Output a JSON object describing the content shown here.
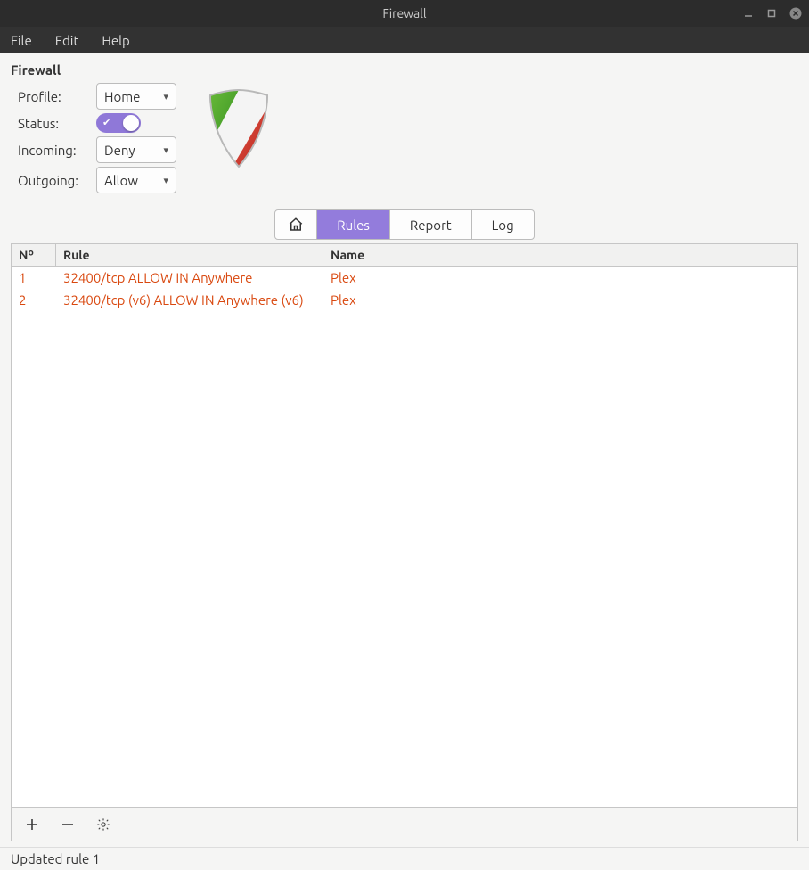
{
  "window": {
    "title": "Firewall"
  },
  "menu": {
    "file": "File",
    "edit": "Edit",
    "help": "Help"
  },
  "section": {
    "heading": "Firewall"
  },
  "form": {
    "profile_label": "Profile:",
    "profile_value": "Home",
    "status_label": "Status:",
    "status_on": true,
    "incoming_label": "Incoming:",
    "incoming_value": "Deny",
    "outgoing_label": "Outgoing:",
    "outgoing_value": "Allow"
  },
  "tabs": {
    "home_icon": "home",
    "rules": "Rules",
    "report": "Report",
    "log": "Log",
    "active": "rules"
  },
  "table": {
    "headers": {
      "no": "Nº",
      "rule": "Rule",
      "name": "Name"
    },
    "rows": [
      {
        "no": "1",
        "rule": "32400/tcp ALLOW IN Anywhere",
        "name": "Plex"
      },
      {
        "no": "2",
        "rule": "32400/tcp (v6) ALLOW IN Anywhere (v6)",
        "name": "Plex"
      }
    ]
  },
  "status": {
    "text": "Updated rule 1"
  },
  "colors": {
    "accent": "#937cdc",
    "row_text": "#d9480f"
  }
}
